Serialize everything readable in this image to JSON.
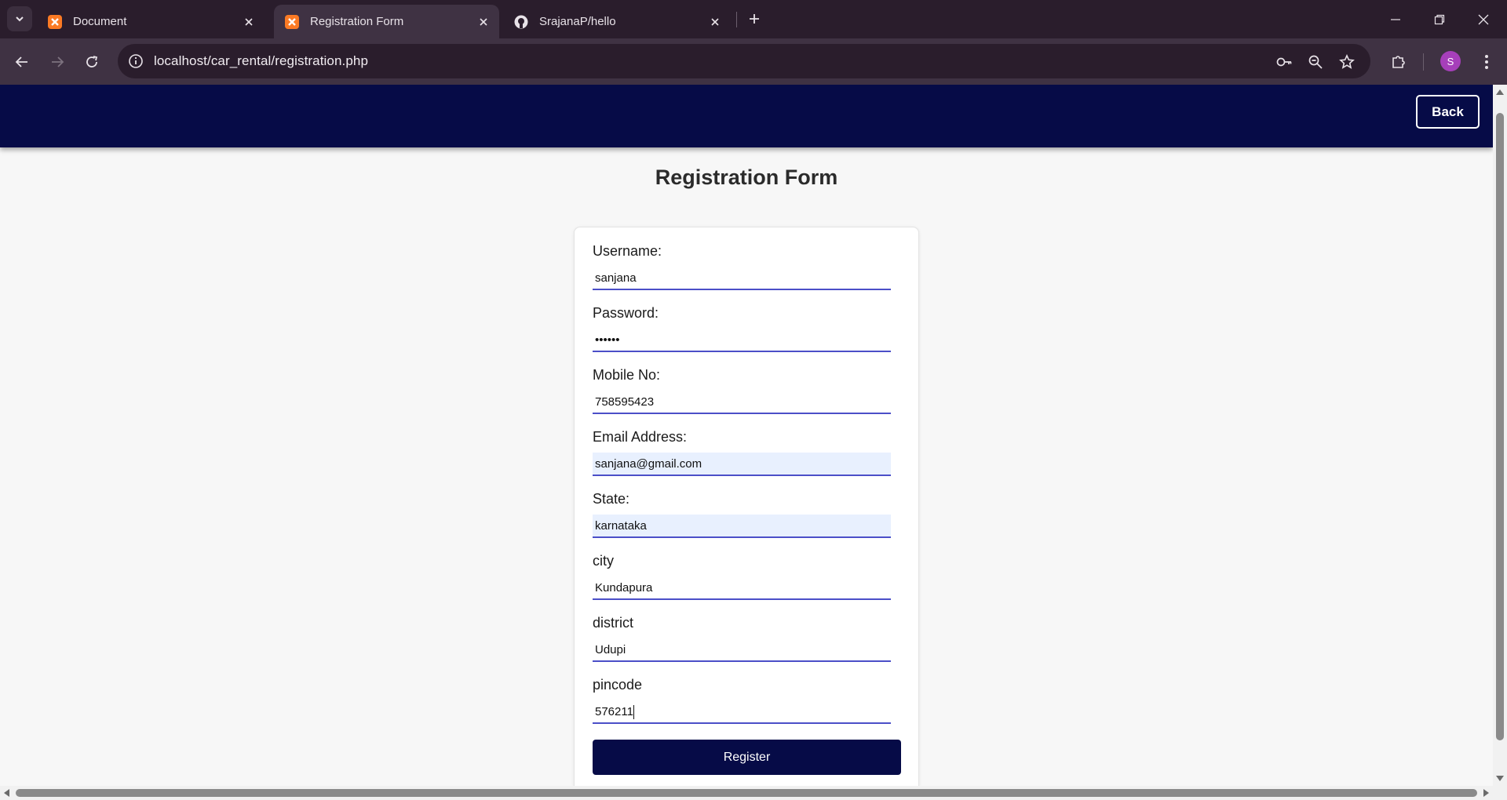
{
  "browser": {
    "tabs": [
      {
        "title": "Document",
        "favicon": "xampp-icon",
        "active": false
      },
      {
        "title": "Registration Form",
        "favicon": "xampp-icon",
        "active": true
      },
      {
        "title": "SrajanaP/hello",
        "favicon": "github-icon",
        "active": false
      }
    ],
    "url": "localhost/car_rental/registration.php",
    "profile_initial": "S",
    "accent_color": "#a63fba"
  },
  "header": {
    "back_label": "Back",
    "background": "#060b47"
  },
  "page": {
    "title": "Registration Form"
  },
  "form": {
    "fields": [
      {
        "label": "Username:",
        "value": "sanjana",
        "type": "text",
        "autofill": false
      },
      {
        "label": "Password:",
        "value": "••••••",
        "type": "password",
        "autofill": false
      },
      {
        "label": "Mobile No:",
        "value": "758595423",
        "type": "text",
        "autofill": false
      },
      {
        "label": "Email Address:",
        "value": "sanjana@gmail.com",
        "type": "email",
        "autofill": true
      },
      {
        "label": "State:",
        "value": "karnataka",
        "type": "text",
        "autofill": true
      },
      {
        "label": "city",
        "value": "Kundapura",
        "type": "text",
        "autofill": false
      },
      {
        "label": "district",
        "value": "Udupi",
        "type": "text",
        "autofill": false
      },
      {
        "label": "pincode",
        "value": "576211",
        "type": "text",
        "autofill": false,
        "focused": true
      }
    ],
    "submit_label": "Register"
  }
}
